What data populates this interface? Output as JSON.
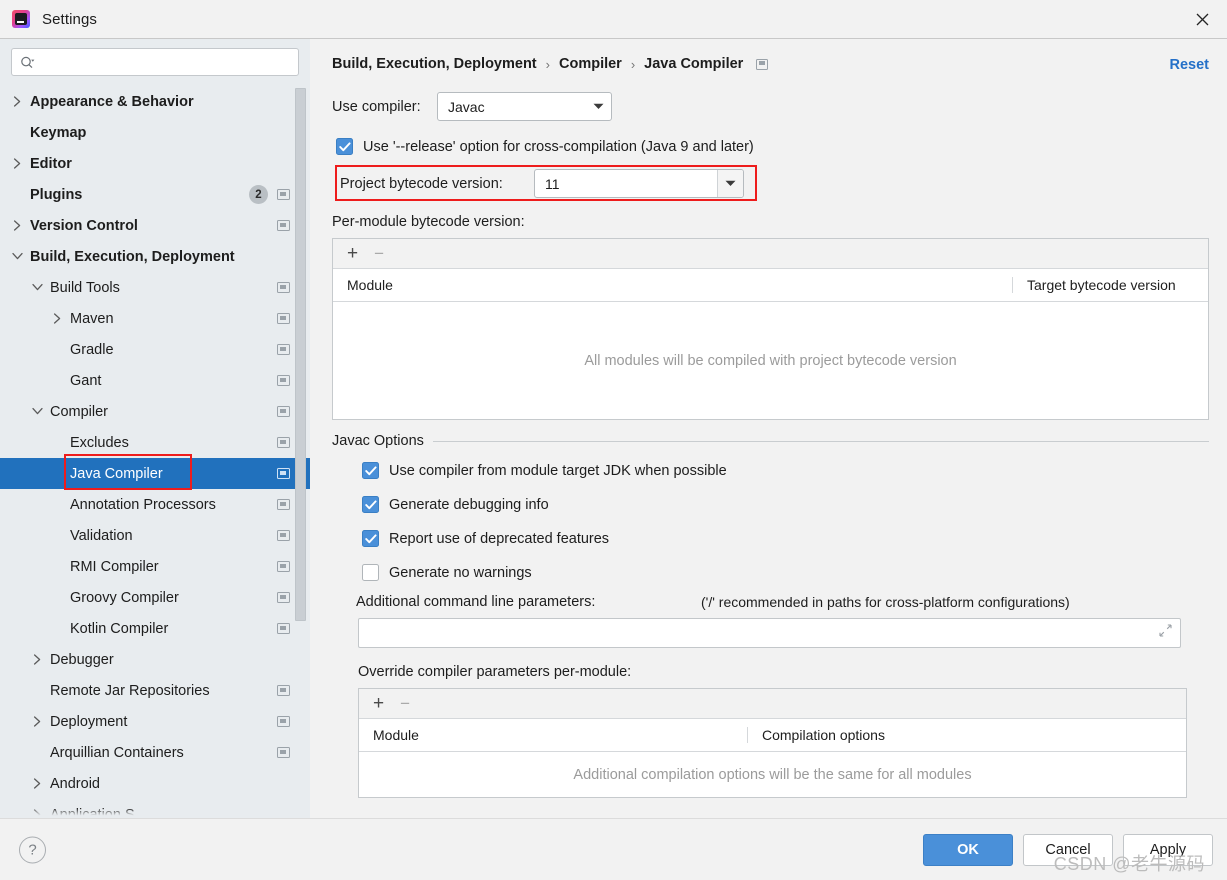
{
  "window": {
    "title": "Settings",
    "app_icon": "intellij-idea-icon",
    "close_icon": "close-icon"
  },
  "sidebar": {
    "search": {
      "placeholder": "",
      "value": "",
      "icon": "search-icon"
    },
    "items": [
      {
        "label": "Appearance & Behavior",
        "indent": 0,
        "twisty": "collapsed",
        "bold": true,
        "cfg": false,
        "badge": null,
        "selected": false,
        "underlined": false
      },
      {
        "label": "Keymap",
        "indent": 0,
        "twisty": "none",
        "bold": true,
        "cfg": false,
        "badge": null,
        "selected": false,
        "underlined": false
      },
      {
        "label": "Editor",
        "indent": 0,
        "twisty": "collapsed",
        "bold": true,
        "cfg": false,
        "badge": null,
        "selected": false,
        "underlined": false
      },
      {
        "label": "Plugins",
        "indent": 0,
        "twisty": "none",
        "bold": true,
        "cfg": true,
        "badge": "2",
        "selected": false,
        "underlined": false
      },
      {
        "label": "Version Control",
        "indent": 0,
        "twisty": "collapsed",
        "bold": true,
        "cfg": true,
        "badge": null,
        "selected": false,
        "underlined": false
      },
      {
        "label": "Build, Execution, Deployment",
        "indent": 0,
        "twisty": "expanded",
        "bold": true,
        "cfg": false,
        "badge": null,
        "selected": false,
        "underlined": true
      },
      {
        "label": "Build Tools",
        "indent": 1,
        "twisty": "expanded",
        "bold": false,
        "cfg": true,
        "badge": null,
        "selected": false,
        "underlined": false
      },
      {
        "label": "Maven",
        "indent": 2,
        "twisty": "collapsed",
        "bold": false,
        "cfg": true,
        "badge": null,
        "selected": false,
        "underlined": false
      },
      {
        "label": "Gradle",
        "indent": 2,
        "twisty": "none",
        "bold": false,
        "cfg": true,
        "badge": null,
        "selected": false,
        "underlined": false
      },
      {
        "label": "Gant",
        "indent": 2,
        "twisty": "none",
        "bold": false,
        "cfg": true,
        "badge": null,
        "selected": false,
        "underlined": false
      },
      {
        "label": "Compiler",
        "indent": 1,
        "twisty": "expanded",
        "bold": false,
        "cfg": true,
        "badge": null,
        "selected": false,
        "underlined": true
      },
      {
        "label": "Excludes",
        "indent": 2,
        "twisty": "none",
        "bold": false,
        "cfg": true,
        "badge": null,
        "selected": false,
        "underlined": false
      },
      {
        "label": "Java Compiler",
        "indent": 2,
        "twisty": "none",
        "bold": false,
        "cfg": true,
        "badge": null,
        "selected": true,
        "underlined": false
      },
      {
        "label": "Annotation Processors",
        "indent": 2,
        "twisty": "none",
        "bold": false,
        "cfg": true,
        "badge": null,
        "selected": false,
        "underlined": false
      },
      {
        "label": "Validation",
        "indent": 2,
        "twisty": "none",
        "bold": false,
        "cfg": true,
        "badge": null,
        "selected": false,
        "underlined": false
      },
      {
        "label": "RMI Compiler",
        "indent": 2,
        "twisty": "none",
        "bold": false,
        "cfg": true,
        "badge": null,
        "selected": false,
        "underlined": false
      },
      {
        "label": "Groovy Compiler",
        "indent": 2,
        "twisty": "none",
        "bold": false,
        "cfg": true,
        "badge": null,
        "selected": false,
        "underlined": false
      },
      {
        "label": "Kotlin Compiler",
        "indent": 2,
        "twisty": "none",
        "bold": false,
        "cfg": true,
        "badge": null,
        "selected": false,
        "underlined": false
      },
      {
        "label": "Debugger",
        "indent": 1,
        "twisty": "collapsed",
        "bold": false,
        "cfg": false,
        "badge": null,
        "selected": false,
        "underlined": false
      },
      {
        "label": "Remote Jar Repositories",
        "indent": 1,
        "twisty": "none",
        "bold": false,
        "cfg": true,
        "badge": null,
        "selected": false,
        "underlined": false
      },
      {
        "label": "Deployment",
        "indent": 1,
        "twisty": "collapsed",
        "bold": false,
        "cfg": true,
        "badge": null,
        "selected": false,
        "underlined": false
      },
      {
        "label": "Arquillian Containers",
        "indent": 1,
        "twisty": "none",
        "bold": false,
        "cfg": true,
        "badge": null,
        "selected": false,
        "underlined": false
      },
      {
        "label": "Android",
        "indent": 1,
        "twisty": "collapsed",
        "bold": false,
        "cfg": false,
        "badge": null,
        "selected": false,
        "underlined": false
      },
      {
        "label": "Application S",
        "indent": 1,
        "twisty": "collapsed",
        "bold": false,
        "cfg": false,
        "badge": null,
        "selected": false,
        "underlined": false
      }
    ]
  },
  "header": {
    "breadcrumb": [
      "Build, Execution, Deployment",
      "Compiler",
      "Java Compiler"
    ],
    "separator": "›",
    "reset_label": "Reset",
    "config_icon": "project-config-icon"
  },
  "main": {
    "use_compiler_label": "Use compiler:",
    "use_compiler_value": "Javac",
    "release_option_label": "Use '--release' option for cross-compilation (Java 9 and later)",
    "release_option_checked": true,
    "project_bytecode_label": "Project bytecode version:",
    "project_bytecode_value": "11",
    "per_module_label": "Per-module bytecode version:",
    "module_table": {
      "add_icon": "plus-icon",
      "remove_icon": "minus-icon",
      "columns": [
        "Module",
        "Target bytecode version"
      ],
      "empty_text": "All modules will be compiled with project bytecode version",
      "rows": []
    },
    "javac_options": {
      "group_title": "Javac Options",
      "checkboxes": [
        {
          "label": "Use compiler from module target JDK when possible",
          "checked": true
        },
        {
          "label": "Generate debugging info",
          "checked": true
        },
        {
          "label": "Report use of deprecated features",
          "checked": true
        },
        {
          "label": "Generate no warnings",
          "checked": false
        }
      ],
      "additional_params_label": "Additional command line parameters:",
      "additional_params_hint": "('/' recommended in paths for cross-platform configurations)",
      "additional_params_value": "",
      "expand_icon": "expand-icon"
    },
    "override_section": {
      "label": "Override compiler parameters per-module:",
      "add_icon": "plus-icon",
      "remove_icon": "minus-icon",
      "columns": [
        "Module",
        "Compilation options"
      ],
      "empty_text": "Additional compilation options will be the same for all modules",
      "rows": []
    }
  },
  "footer": {
    "help_icon": "help-icon",
    "help_label": "?",
    "ok_label": "OK",
    "cancel_label": "Cancel",
    "apply_label": "Apply"
  },
  "watermark": "CSDN @老牛源码",
  "colors": {
    "accent": "#4a90d9",
    "selection": "#2171bd",
    "link": "#2470c8",
    "annotation": "#ee1c1c",
    "sidebar_bg": "#e8ecef",
    "panel_bg": "#f2f2f2"
  }
}
